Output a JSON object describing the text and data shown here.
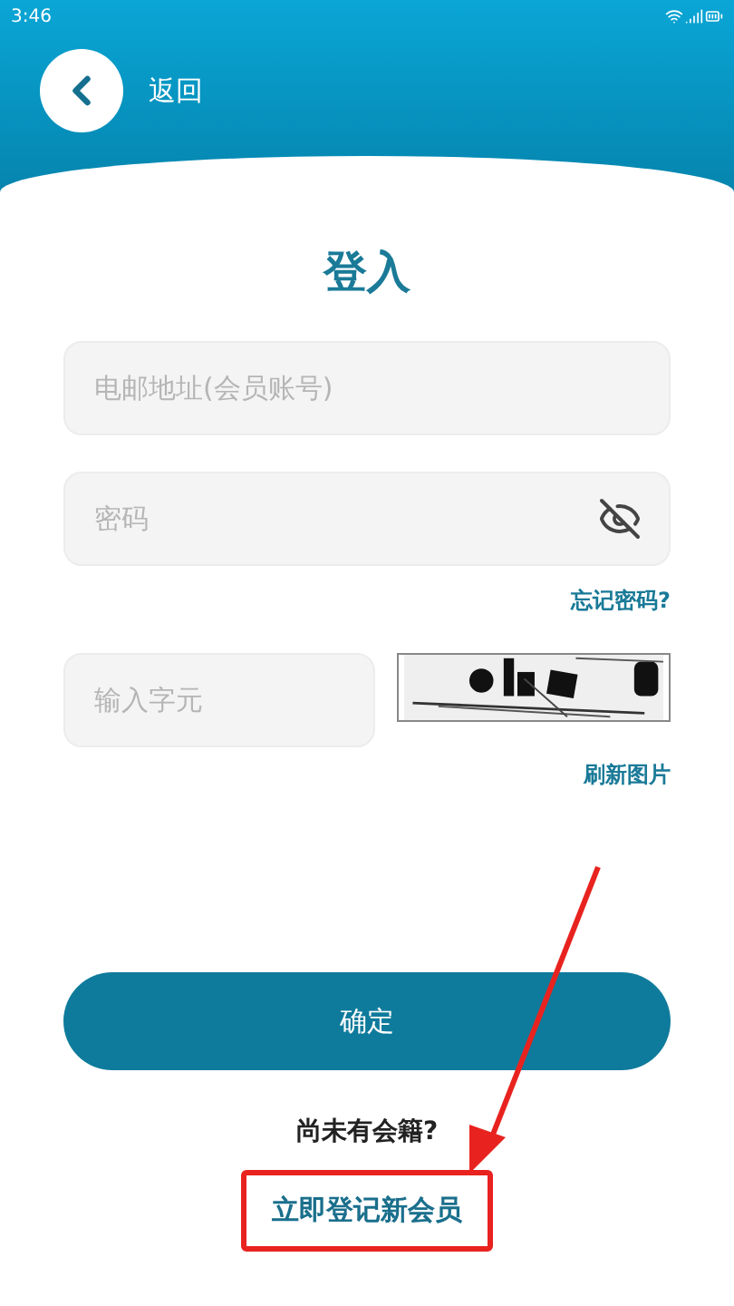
{
  "status_bar": {
    "time": "3:46"
  },
  "header": {
    "back_label": "返回"
  },
  "title": "登入",
  "fields": [
    {
      "kind": "text",
      "placeholder": "电邮地址(会员账号)"
    },
    {
      "kind": "password",
      "placeholder": "密码"
    }
  ],
  "forgot_link": "忘记密码?",
  "captcha": {
    "placeholder": "输入字元",
    "refresh_link": "刷新图片"
  },
  "submit_button": "确定",
  "signup": {
    "prompt": "尚未有会籍?",
    "link": "立即登记新会员"
  }
}
